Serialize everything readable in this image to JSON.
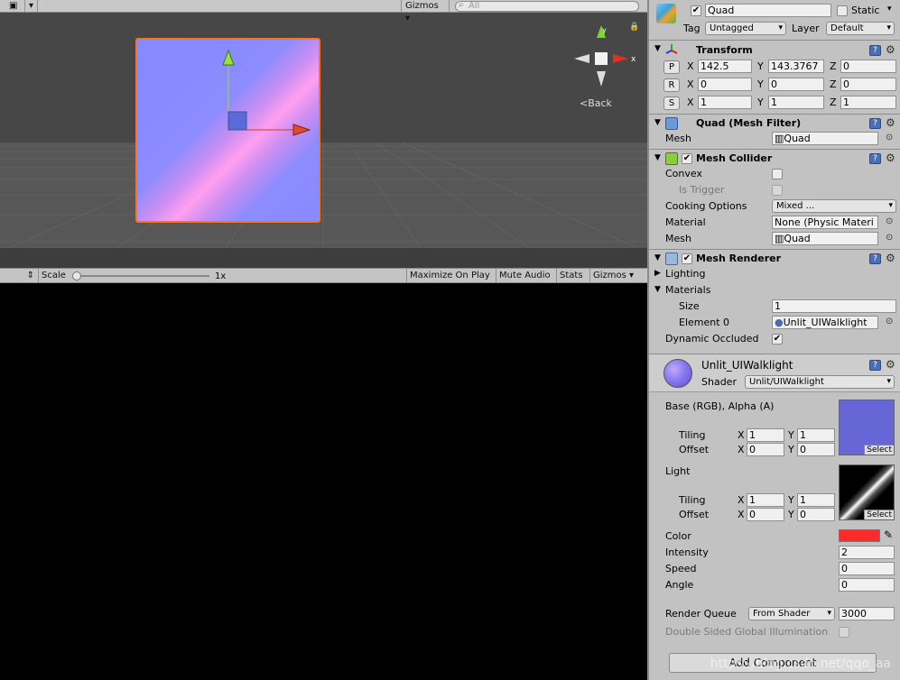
{
  "scene": {
    "gizmos_label": "Gizmos",
    "search_placeholder": "All",
    "back_label": "Back",
    "axis_x": "x",
    "axis_y": "y"
  },
  "game_toolbar": {
    "scale_label": "Scale",
    "scale_value": "1x",
    "buttons": [
      "Maximize On Play",
      "Mute Audio",
      "Stats",
      "Gizmos"
    ]
  },
  "object": {
    "name": "Quad",
    "static_label": "Static",
    "tag_label": "Tag",
    "tag_value": "Untagged",
    "layer_label": "Layer",
    "layer_value": "Default"
  },
  "transform": {
    "title": "Transform",
    "position": {
      "btn": "P",
      "x": "142.5",
      "y": "143.3767",
      "z": "0"
    },
    "rotation": {
      "btn": "R",
      "x": "0",
      "y": "0",
      "z": "0"
    },
    "scale": {
      "btn": "S",
      "x": "1",
      "y": "1",
      "z": "1"
    },
    "x_label": "X",
    "y_label": "Y",
    "z_label": "Z"
  },
  "mesh_filter": {
    "title": "Quad (Mesh Filter)",
    "mesh_label": "Mesh",
    "mesh_value": "Quad"
  },
  "mesh_collider": {
    "title": "Mesh Collider",
    "convex_label": "Convex",
    "is_trigger_label": "Is Trigger",
    "cooking_label": "Cooking Options",
    "cooking_value": "Mixed ...",
    "material_label": "Material",
    "material_value": "None (Physic Materi",
    "mesh_label": "Mesh",
    "mesh_value": "Quad"
  },
  "mesh_renderer": {
    "title": "Mesh Renderer",
    "lighting_label": "Lighting",
    "materials_label": "Materials",
    "size_label": "Size",
    "size_value": "1",
    "element0_label": "Element 0",
    "element0_value": "Unlit_UIWalklight",
    "dyn_occluded_label": "Dynamic Occluded"
  },
  "material": {
    "name": "Unlit_UIWalklight",
    "shader_label": "Shader",
    "shader_value": "Unlit/UIWalklight",
    "base_label": "Base (RGB), Alpha (A)",
    "tiling_label": "Tiling",
    "offset_label": "Offset",
    "base_tiling": {
      "x": "1",
      "y": "1"
    },
    "base_offset": {
      "x": "0",
      "y": "0"
    },
    "light_label": "Light",
    "light_tiling": {
      "x": "1",
      "y": "1"
    },
    "light_offset": {
      "x": "0",
      "y": "0"
    },
    "select_label": "Select",
    "color_label": "Color",
    "color_value": "#ff2a2a",
    "intensity_label": "Intensity",
    "intensity_value": "2",
    "speed_label": "Speed",
    "speed_value": "0",
    "angle_label": "Angle",
    "angle_value": "0",
    "render_queue_label": "Render Queue",
    "render_queue_mode": "From Shader",
    "render_queue_value": "3000",
    "dsgi_label": "Double Sided Global Illumination"
  },
  "add_component_label": "Add Component",
  "watermark": "https://blog.csdn.net/qqo_aa"
}
